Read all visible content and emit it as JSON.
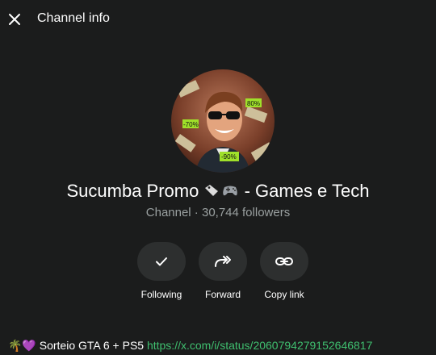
{
  "header": {
    "title": "Channel info",
    "close_icon": "close-icon"
  },
  "channel": {
    "name_part1": "Sucumba Promo",
    "name_part2": " - Games e Tech",
    "meta": "Channel · 30,744 followers",
    "avatar_badges": [
      "-70%",
      "80%",
      "-90%",
      "-75"
    ]
  },
  "actions": [
    {
      "label": "Following",
      "icon": "check-icon"
    },
    {
      "label": "Forward",
      "icon": "forward-icon"
    },
    {
      "label": "Copy link",
      "icon": "link-icon"
    }
  ],
  "bottom": {
    "text": "🌴💜 Sorteio GTA 6 + PS5 ",
    "link": "https://x.com/i/status/2060794279152646817"
  },
  "colors": {
    "background": "#1b1c1c",
    "button_bg": "#2d2f2f",
    "muted_text": "#9aa0a0",
    "link": "#3fbf6f"
  }
}
